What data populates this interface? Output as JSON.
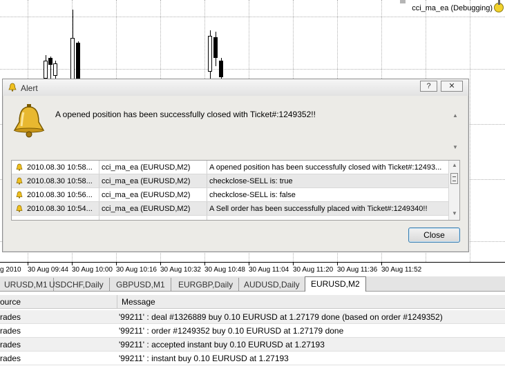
{
  "chart": {
    "ea_label": "cci_ma_ea (Debugging)",
    "time_labels": [
      "g 2010",
      "30 Aug 09:44",
      "30 Aug 10:00",
      "30 Aug 10:16",
      "30 Aug 10:32",
      "30 Aug 10:48",
      "30 Aug 11:04",
      "30 Aug 11:20",
      "30 Aug 11:36",
      "30 Aug 11:52"
    ]
  },
  "alert": {
    "title": "Alert",
    "help_btn": "?",
    "close_x": "✕",
    "message": "A opened position has been successfully closed with Ticket#:1249352!!",
    "rows": [
      {
        "time": "2010.08.30 10:58...",
        "expert": "cci_ma_ea (EURUSD,M2)",
        "message": "A opened position has been successfully closed with Ticket#:12493..."
      },
      {
        "time": "2010.08.30 10:58...",
        "expert": "cci_ma_ea (EURUSD,M2)",
        "message": "checkclose-SELL is: true"
      },
      {
        "time": "2010.08.30 10:56...",
        "expert": "cci_ma_ea (EURUSD,M2)",
        "message": "checkclose-SELL is: false"
      },
      {
        "time": "2010.08.30 10:54...",
        "expert": "cci_ma_ea (EURUSD,M2)",
        "message": "A Sell order has been successfully placed with Ticket#:1249340!!"
      }
    ],
    "close_label": "Close"
  },
  "tabs": [
    "URUSD,M1",
    "USDCHF,Daily",
    "GBPUSD,M1",
    "EURGBP,Daily",
    "AUDUSD,Daily",
    "EURUSD,M2"
  ],
  "active_tab": "EURUSD,M2",
  "log": {
    "headers": {
      "source": "ource",
      "message": "Message"
    },
    "rows": [
      {
        "source": "rades",
        "message": "'99211' : deal #1326889 buy 0.10 EURUSD at 1.27179 done (based on order #1249352)"
      },
      {
        "source": "rades",
        "message": "'99211' : order #1249352 buy 0.10 EURUSD at 1.27179 done"
      },
      {
        "source": "rades",
        "message": "'99211' : accepted instant buy 0.10 EURUSD at 1.27193"
      },
      {
        "source": "rades",
        "message": "'99211' : instant buy 0.10 EURUSD at 1.27193"
      }
    ]
  }
}
